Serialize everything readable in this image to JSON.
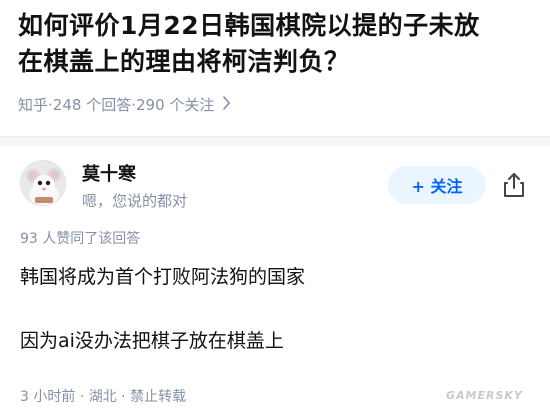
{
  "question": {
    "title": "如何评价1月22日韩国棋院以提的子未放在棋盖上的理由将柯洁判负？",
    "source": "知乎",
    "answer_count": "248 个回答",
    "follower_count": "290 个关注",
    "separator": " · "
  },
  "answer": {
    "author_name": "莫十寒",
    "author_bio": "嗯，您说的都对",
    "follow_label": "+ 关注",
    "upvote_info": "93 人赞同了该回答",
    "paragraphs": [
      "韩国将成为首个打败阿法狗的国家",
      "因为ai没办法把棋子放在棋盖上"
    ],
    "time": "3 小时前",
    "location": "湖北",
    "repost": "禁止转载"
  },
  "watermark": "GAMERSKY",
  "icons": {
    "chevron": "chevron-right-icon",
    "share": "share-icon",
    "avatar": "mouse-avatar"
  },
  "colors": {
    "accent": "#0066ff",
    "follow_bg": "#ebf5ff",
    "meta": "#8590a6",
    "text": "#121212"
  }
}
